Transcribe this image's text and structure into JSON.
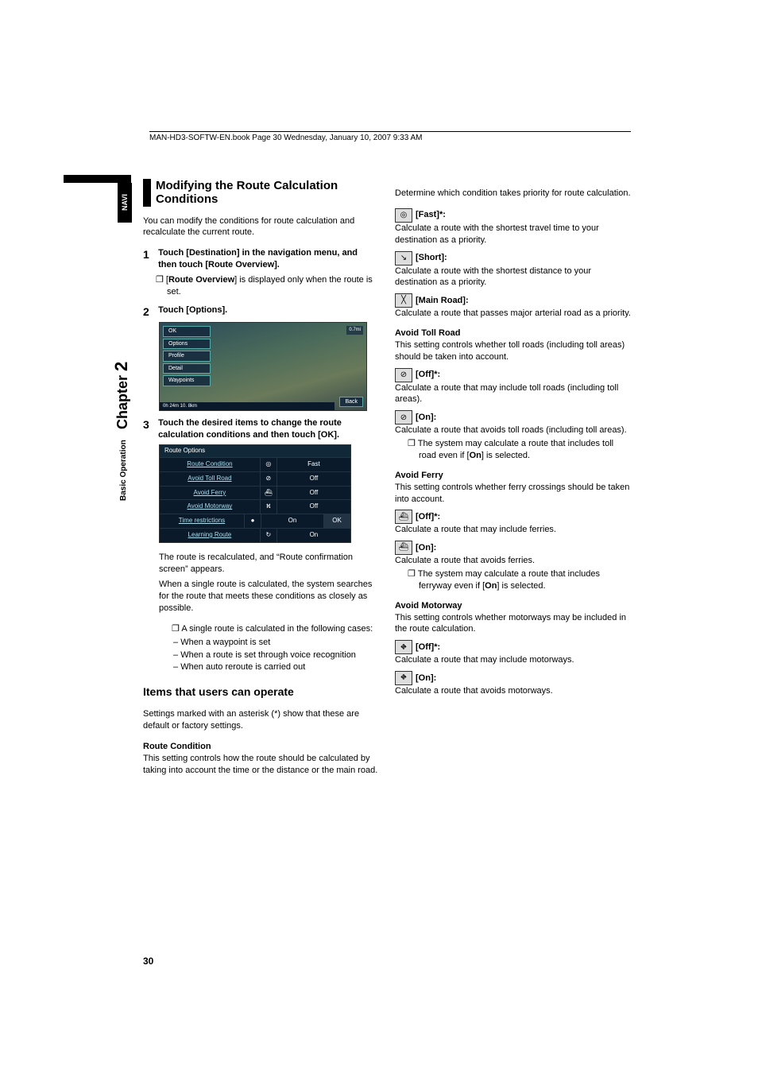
{
  "header": {
    "runner": "MAN-HD3-SOFTW-EN.book  Page 30  Wednesday, January 10, 2007  9:33 AM"
  },
  "sidebar": {
    "navi": "NAVI",
    "chapter_label": "Chapter",
    "chapter_num": "2",
    "section": "Basic Operation"
  },
  "left": {
    "h2": "Modifying the Route Calculation Conditions",
    "intro": "You can modify the conditions for route calculation and recalculate the current route.",
    "steps": [
      {
        "n": "1",
        "title": "Touch [Destination] in the navigation menu, and then touch [Route Overview].",
        "bullets": [
          {
            "pre": "[",
            "bold": "Route Overview",
            "post": "] is displayed only when the route is set."
          }
        ]
      },
      {
        "n": "2",
        "title": "Touch [Options]."
      },
      {
        "n": "3",
        "title": "Touch the desired items to change the route calculation conditions and then touch [OK]."
      }
    ],
    "map_menu": [
      "OK",
      "Options",
      "Profile",
      "Detail",
      "Waypoints"
    ],
    "map_back": "Back",
    "map_status": "0h 24m   10. 8km",
    "map_dist": "0.7mi",
    "route_options": {
      "title": "Route Options",
      "rows": [
        {
          "label": "Route Condition",
          "icon": "◎",
          "value": "Fast",
          "ok": ""
        },
        {
          "label": "Avoid Toll Road",
          "icon": "⊘",
          "value": "Off",
          "ok": ""
        },
        {
          "label": "Avoid Ferry",
          "icon": "⛴",
          "value": "Off",
          "ok": ""
        },
        {
          "label": "Avoid Motorway",
          "icon": "⛕",
          "value": "Off",
          "ok": ""
        },
        {
          "label": "Time restrictions",
          "icon": "●",
          "value": "On",
          "ok": "OK"
        },
        {
          "label": "Learning Route",
          "icon": "↻",
          "value": "On",
          "ok": ""
        }
      ]
    },
    "after_table_p1": "The route is recalculated, and “Route confirmation screen” appears.",
    "after_table_p2": "When a single route is calculated, the system searches for the route that meets these conditions as closely as possible.",
    "after_table_bullet": "A single route is calculated in the following cases:",
    "dashes": [
      "When a waypoint is set",
      "When a route is set through voice recognition",
      "When auto reroute is carried out"
    ],
    "h3": "Items that users can operate",
    "asterisk_note": "Settings marked with an asterisk (*) show that these are default or factory settings.",
    "rc_head": "Route Condition",
    "rc_desc": "This setting controls how the route should be calculated by taking into account the time or the distance or the main road."
  },
  "right": {
    "intro": "Determine which condition takes priority for route calculation.",
    "fast": {
      "label": "[Fast]*:",
      "desc": "Calculate a route with the shortest travel time to your destination as a priority."
    },
    "short": {
      "label": "[Short]:",
      "desc": "Calculate a route with the shortest distance to your destination as a priority."
    },
    "main": {
      "label": "[Main Road]:",
      "desc": "Calculate a route that passes major arterial road as a priority."
    },
    "toll_head": "Avoid Toll Road",
    "toll_desc": "This setting controls whether toll roads (including toll areas) should be taken into account.",
    "toll_off": {
      "label": "[Off]*:",
      "desc": "Calculate a route that may include toll roads (including toll areas)."
    },
    "toll_on": {
      "label": "[On]:",
      "desc": "Calculate a route that avoids toll roads (including toll areas)."
    },
    "toll_note_pre": "The system may calculate a route that includes toll road even if [",
    "toll_note_bold": "On",
    "toll_note_post": "] is selected.",
    "ferry_head": "Avoid Ferry",
    "ferry_desc": "This setting controls whether ferry crossings should be taken into account.",
    "ferry_off": {
      "label": "[Off]*:",
      "desc": "Calculate a route that may include ferries."
    },
    "ferry_on": {
      "label": "[On]:",
      "desc": "Calculate a route that avoids ferries."
    },
    "ferry_note_pre": "The system may calculate a route that includes ferryway even if [",
    "ferry_note_bold": "On",
    "ferry_note_post": "] is selected.",
    "mw_head": "Avoid Motorway",
    "mw_desc": "This setting controls whether motorways may be included in the route calculation.",
    "mw_off": {
      "label": "[Off]*:",
      "desc": "Calculate a route that may include motorways."
    },
    "mw_on": {
      "label": "[On]:",
      "desc": "Calculate a route that avoids motorways."
    }
  },
  "page_number": "30"
}
